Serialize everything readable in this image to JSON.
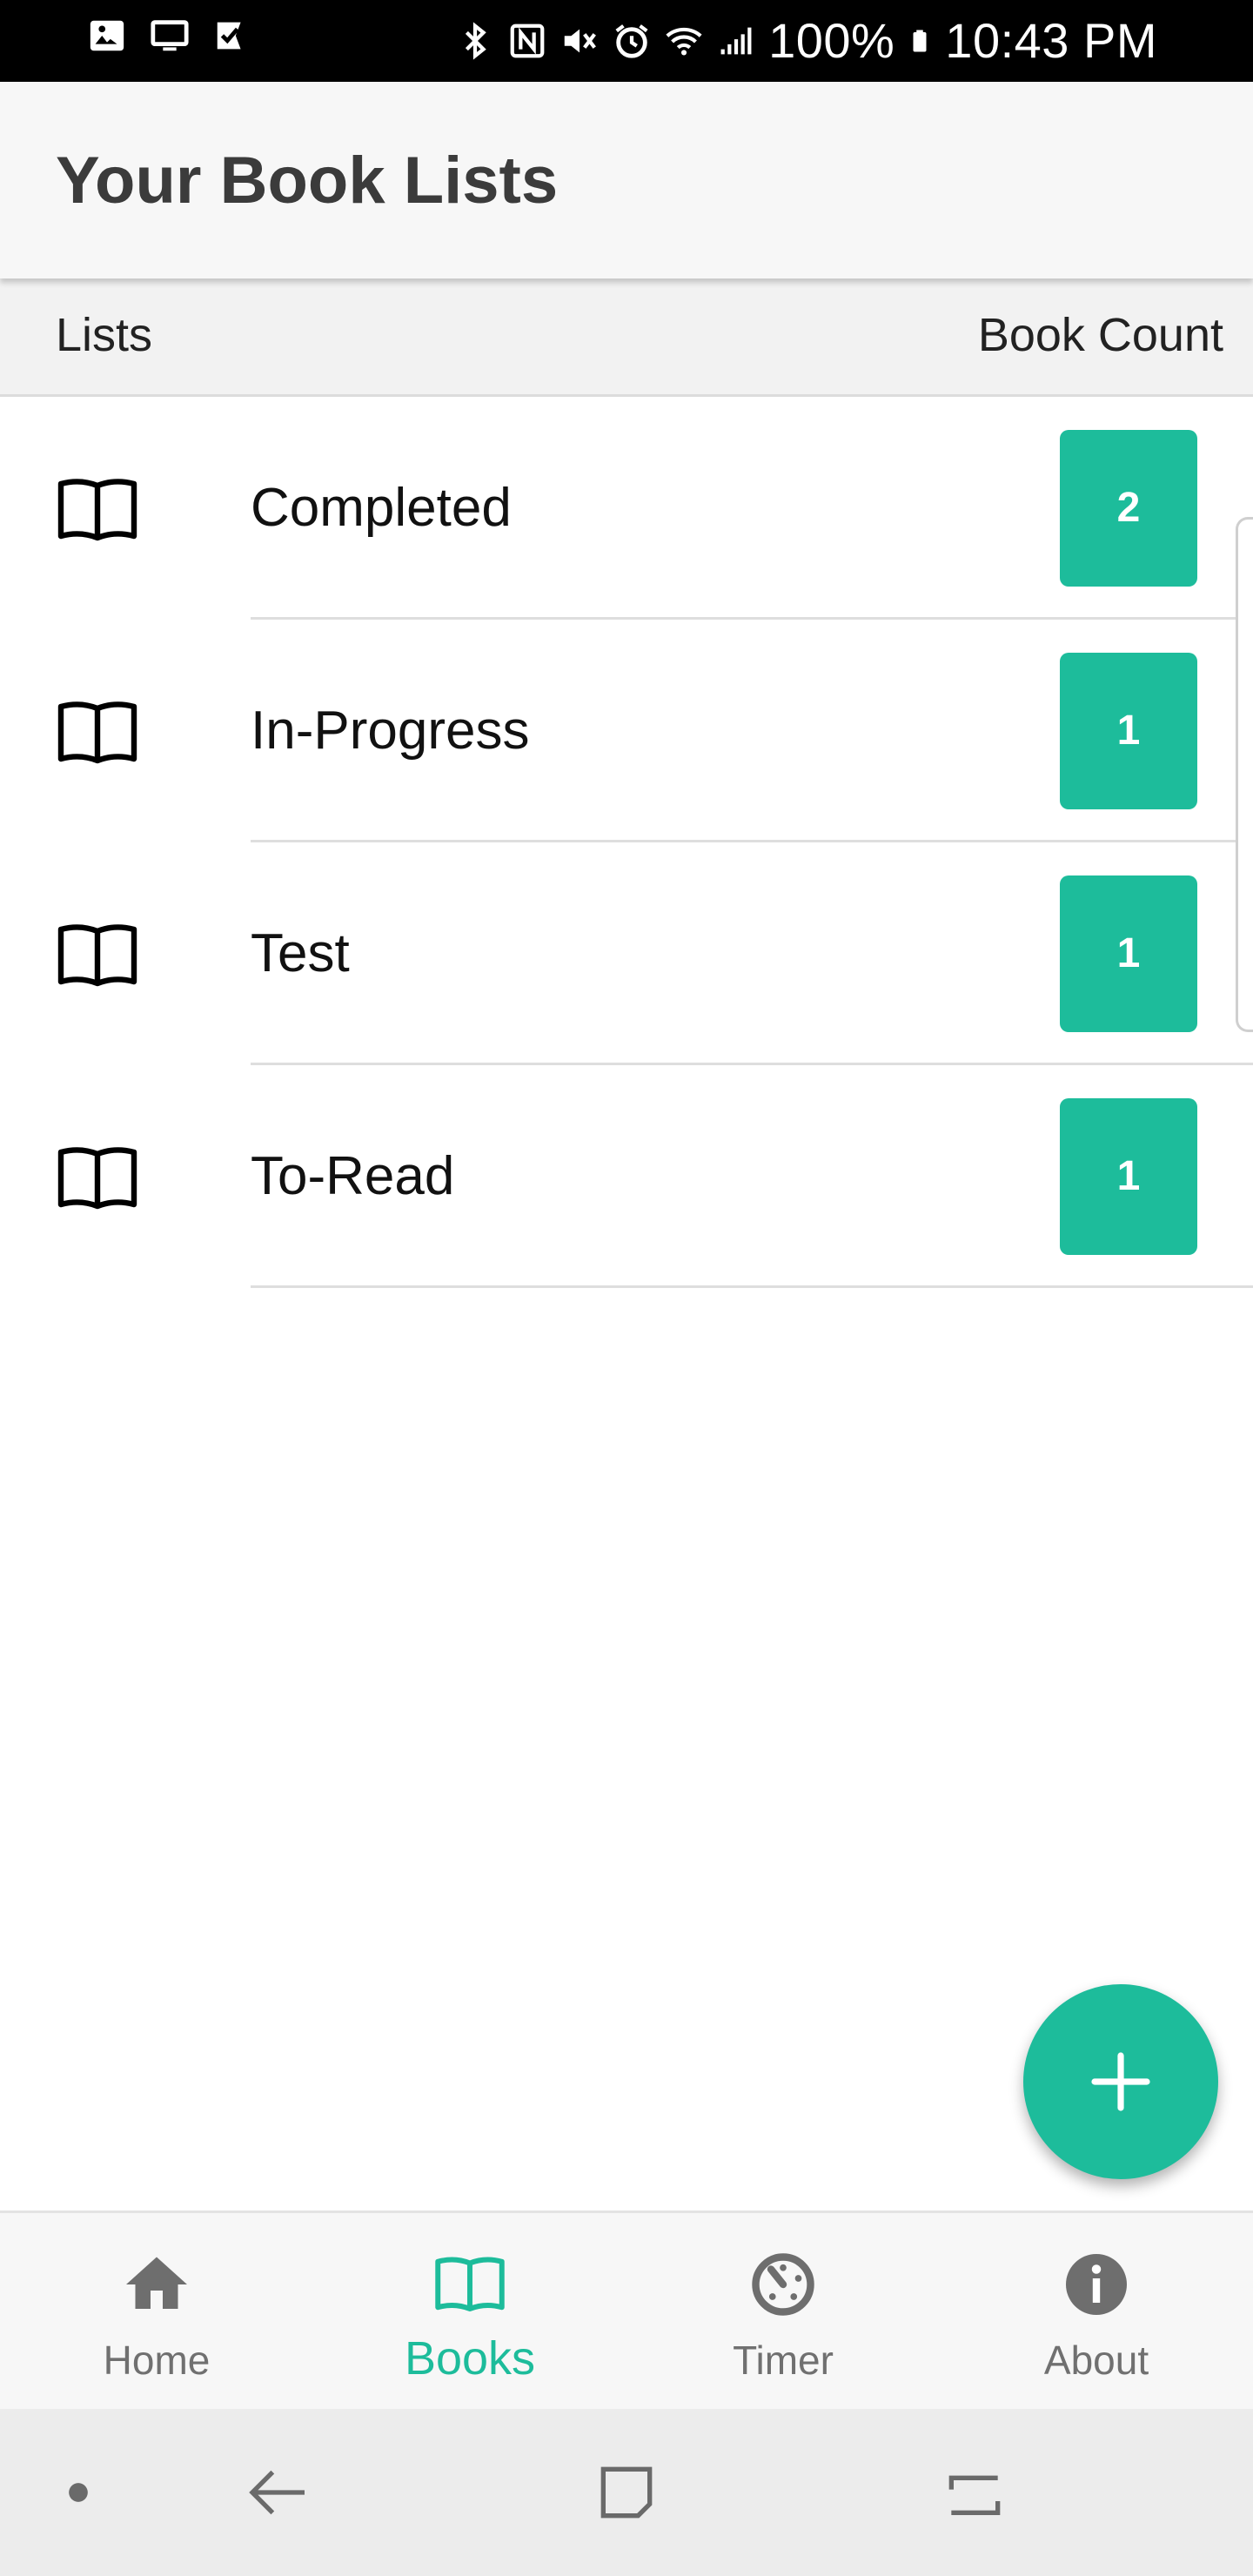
{
  "status_bar": {
    "battery": "100%",
    "time": "10:43 PM",
    "icons_left": [
      "image-icon",
      "cast-screen-icon",
      "checkbox-app-icon"
    ],
    "icons_right": [
      "bluetooth-icon",
      "nfc-icon",
      "mute-icon",
      "alarm-icon",
      "wifi-icon",
      "signal-icon",
      "battery-icon"
    ]
  },
  "header": {
    "title": "Your Book Lists"
  },
  "columns": {
    "left": "Lists",
    "right": "Book Count"
  },
  "lists": [
    {
      "name": "Completed",
      "count": "2"
    },
    {
      "name": "In-Progress",
      "count": "1"
    },
    {
      "name": "Test",
      "count": "1"
    },
    {
      "name": "To-Read",
      "count": "1"
    }
  ],
  "fab": {
    "icon": "plus-icon"
  },
  "bottom_nav": {
    "tabs": [
      {
        "label": "Home",
        "icon": "home-icon",
        "active": false
      },
      {
        "label": "Books",
        "icon": "book-icon",
        "active": true
      },
      {
        "label": "Timer",
        "icon": "timer-icon",
        "active": false
      },
      {
        "label": "About",
        "icon": "info-icon",
        "active": false
      }
    ]
  },
  "system_nav": {
    "icons": [
      "dot-icon",
      "back-icon",
      "home-square-icon",
      "recents-icon"
    ]
  },
  "colors": {
    "accent": "#1dbc9b",
    "header_bg": "#f7f7f7",
    "status_bg": "#000000"
  }
}
